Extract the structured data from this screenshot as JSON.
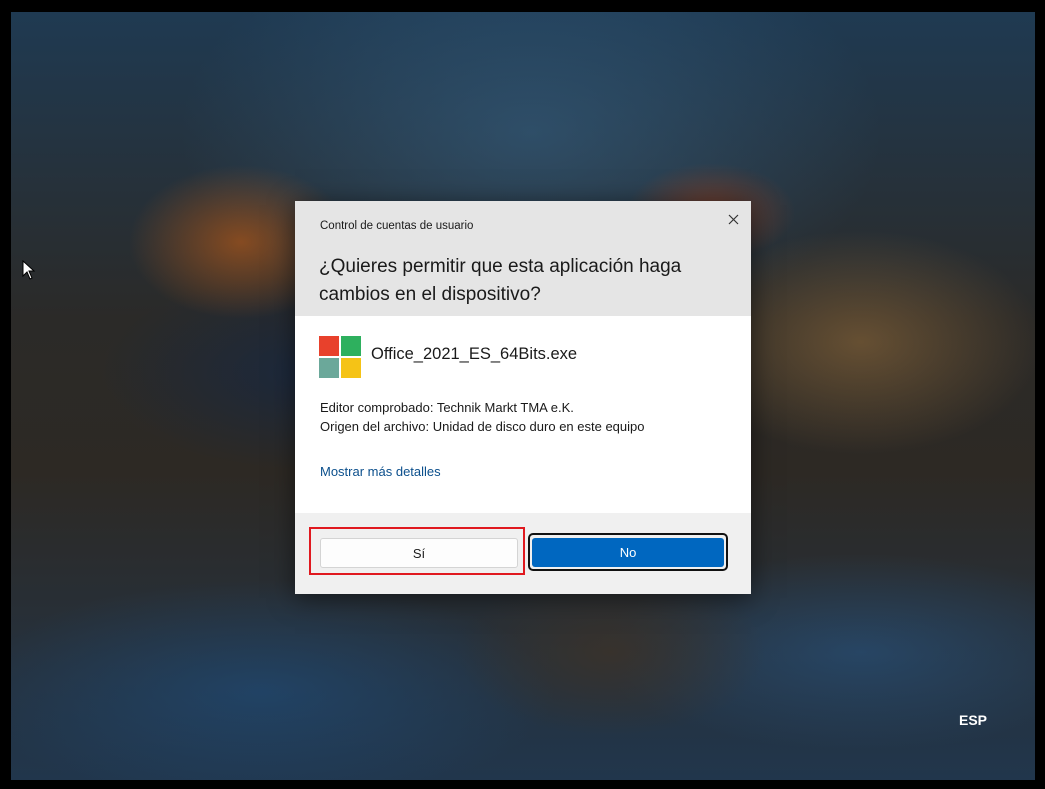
{
  "desktop": {
    "language_indicator": "ESP"
  },
  "uac_dialog": {
    "caption": "Control de cuentas de usuario",
    "question": "¿Quieres permitir que esta aplicación haga cambios en el dispositivo?",
    "close_icon": "close-icon",
    "app_icon": "office-app-icon",
    "app_name": "Office_2021_ES_64Bits.exe",
    "publisher_line": "Editor comprobado: Technik Markt TMA e.K.",
    "origin_line": "Origen del archivo: Unidad de disco duro en este equipo",
    "details_link": "Mostrar más detalles",
    "yes_label": "Sí",
    "no_label": "No"
  },
  "colors": {
    "accent": "#0067c0",
    "link": "#0b4f8c",
    "highlight_box": "#e0191f",
    "icon_red": "#e8412c",
    "icon_green": "#2eb05e",
    "icon_teal": "#6ba89a",
    "icon_yellow": "#f5c316"
  }
}
